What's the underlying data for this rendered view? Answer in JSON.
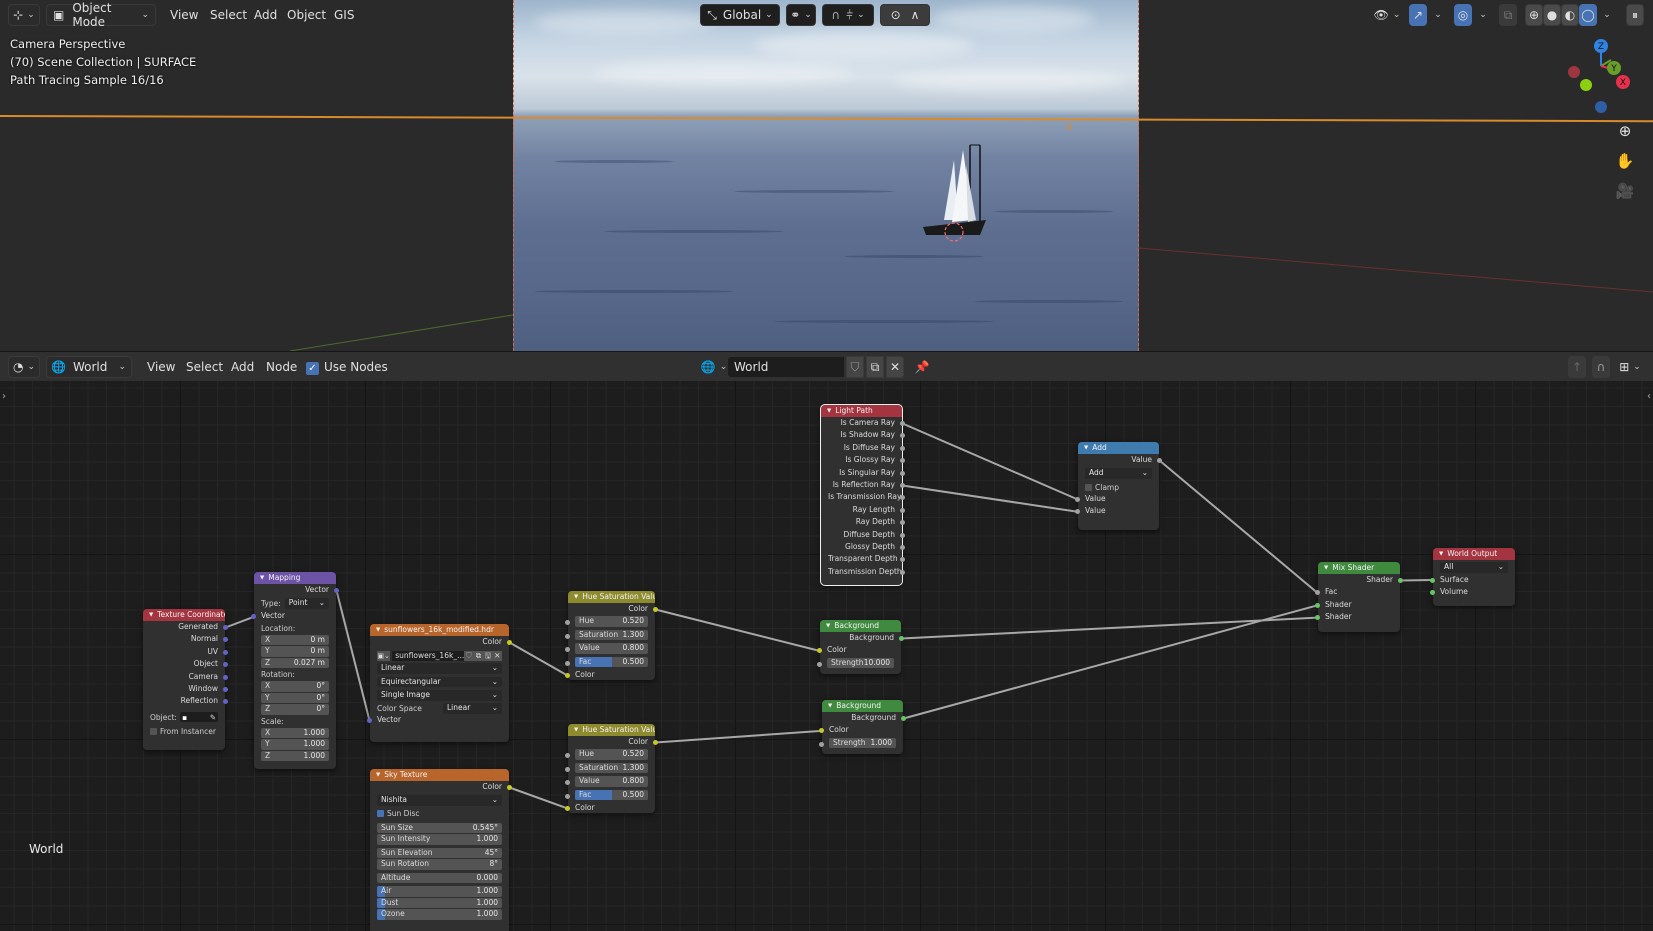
{
  "viewport": {
    "editor_type_icon": "3d-viewport-icon",
    "mode_label": "Object Mode",
    "menus": [
      "View",
      "Select",
      "Add",
      "Object",
      "GIS"
    ],
    "info_lines": [
      "Camera Perspective",
      "(70) Scene Collection | SURFACE",
      "Path Tracing Sample 16/16"
    ],
    "transform_orientation": "Global",
    "gizmo_axes": [
      "Z",
      "Y",
      "X"
    ],
    "shading_modes": [
      "wireframe",
      "solid",
      "material-preview",
      "rendered"
    ],
    "active_shading": "rendered",
    "accent_color": "#4772b3",
    "selection_outline_color": "#d98a2b"
  },
  "node_editor": {
    "editor_type_icon": "shader-editor-icon",
    "shader_type": "World",
    "menus": [
      "View",
      "Select",
      "Add",
      "Node"
    ],
    "use_nodes_label": "Use Nodes",
    "use_nodes_checked": true,
    "datablock_name": "World",
    "tree_label": "World"
  },
  "nodes": {
    "texture_coordinate": {
      "title": "Texture Coordinate",
      "outputs": [
        "Generated",
        "Normal",
        "UV",
        "Object",
        "Camera",
        "Window",
        "Reflection"
      ],
      "object_label": "Object:",
      "from_instancer_label": "From Instancer"
    },
    "mapping": {
      "title": "Mapping",
      "output": "Vector",
      "type_label": "Type:",
      "type_value": "Point",
      "vector_input": "Vector",
      "location_label": "Location:",
      "location": [
        {
          "axis": "X",
          "value": "0 m"
        },
        {
          "axis": "Y",
          "value": "0 m"
        },
        {
          "axis": "Z",
          "value": "0.027 m"
        }
      ],
      "rotation_label": "Rotation:",
      "rotation": [
        {
          "axis": "X",
          "value": "0°"
        },
        {
          "axis": "Y",
          "value": "0°"
        },
        {
          "axis": "Z",
          "value": "0°"
        }
      ],
      "scale_label": "Scale:",
      "scale": [
        {
          "axis": "X",
          "value": "1.000"
        },
        {
          "axis": "Y",
          "value": "1.000"
        },
        {
          "axis": "Z",
          "value": "1.000"
        }
      ]
    },
    "env_texture": {
      "title": "sunflowers_16k_modified.hdr",
      "output": "Color",
      "image_name": "sunflowers_16k_...",
      "interpolation": "Linear",
      "projection": "Equirectangular",
      "source": "Single Image",
      "color_space_label": "Color Space",
      "color_space": "Linear",
      "vector_input": "Vector"
    },
    "sky_texture": {
      "title": "Sky Texture",
      "output": "Color",
      "sky_type": "Nishita",
      "sun_disc_label": "Sun Disc",
      "sun_disc": true,
      "fields": [
        {
          "label": "Sun Size",
          "value": "0.545°"
        },
        {
          "label": "Sun Intensity",
          "value": "1.000"
        },
        {
          "label": "Sun Elevation",
          "value": "45°"
        },
        {
          "label": "Sun Rotation",
          "value": "8°"
        },
        {
          "label": "Altitude",
          "value": "0.000"
        },
        {
          "label": "Air",
          "value": "1.000"
        },
        {
          "label": "Dust",
          "value": "1.000"
        },
        {
          "label": "Ozone",
          "value": "1.000"
        }
      ]
    },
    "hsv_1": {
      "title": "Hue Saturation Value",
      "output": "Color",
      "hue_label": "Hue",
      "hue": "0.520",
      "saturation_label": "Saturation",
      "saturation": "1.300",
      "value_label": "Value",
      "value": "0.800",
      "fac_label": "Fac",
      "fac": "0.500",
      "fac_fraction": 0.5,
      "color_input": "Color"
    },
    "hsv_2": {
      "title": "Hue Saturation Value",
      "output": "Color",
      "hue_label": "Hue",
      "hue": "0.520",
      "saturation_label": "Saturation",
      "saturation": "1.300",
      "value_label": "Value",
      "value": "0.800",
      "fac_label": "Fac",
      "fac": "0.500",
      "fac_fraction": 0.5,
      "color_input": "Color"
    },
    "light_path": {
      "title": "Light Path",
      "outputs": [
        "Is Camera Ray",
        "Is Shadow Ray",
        "Is Diffuse Ray",
        "Is Glossy Ray",
        "Is Singular Ray",
        "Is Reflection Ray",
        "Is Transmission Ray",
        "Ray Length",
        "Ray Depth",
        "Diffuse Depth",
        "Glossy Depth",
        "Transparent Depth",
        "Transmission Depth"
      ]
    },
    "background_1": {
      "title": "Background",
      "output": "Background",
      "color_input": "Color",
      "strength_label": "Strength",
      "strength": "10.000"
    },
    "background_2": {
      "title": "Background",
      "output": "Background",
      "color_input": "Color",
      "strength_label": "Strength",
      "strength": "1.000"
    },
    "math_add": {
      "title": "Add",
      "output": "Value",
      "operation": "Add",
      "clamp_label": "Clamp",
      "inputs": [
        "Value",
        "Value"
      ]
    },
    "mix_shader": {
      "title": "Mix Shader",
      "output": "Shader",
      "inputs": [
        "Fac",
        "Shader",
        "Shader"
      ]
    },
    "world_output": {
      "title": "World Output",
      "target": "All",
      "inputs": [
        "Surface",
        "Volume"
      ]
    }
  }
}
